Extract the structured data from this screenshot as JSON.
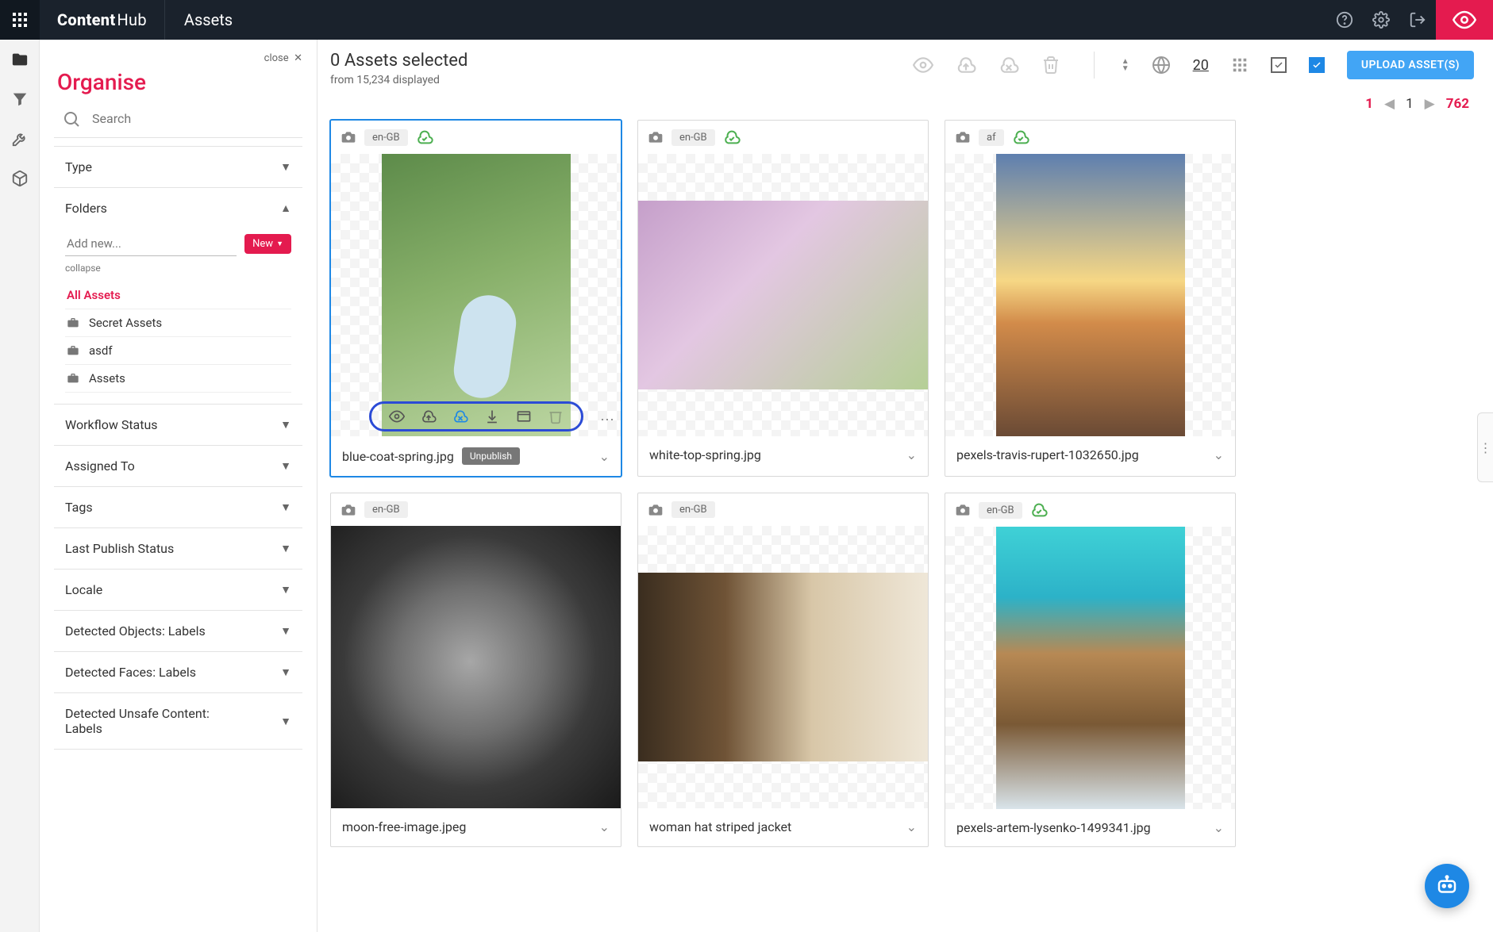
{
  "header": {
    "brand_bold": "Content",
    "brand_light": "Hub",
    "section": "Assets"
  },
  "sidebar": {
    "close_label": "close",
    "title": "Organise",
    "search_placeholder": "Search",
    "new_button": "New",
    "addnew_placeholder": "Add new...",
    "collapse_label": "collapse",
    "all_assets_label": "All Assets",
    "folders": [
      "Secret Assets",
      "asdf",
      "Assets"
    ],
    "accordion": {
      "type": "Type",
      "folders": "Folders",
      "workflow": "Workflow Status",
      "assigned": "Assigned To",
      "tags": "Tags",
      "last_publish": "Last Publish Status",
      "locale": "Locale",
      "objects": "Detected Objects: Labels",
      "faces": "Detected Faces: Labels",
      "unsafe": "Detected Unsafe Content: Labels"
    }
  },
  "main": {
    "selected_text": "0 Assets selected",
    "from_text": "from 15,234 displayed",
    "page_size": "20",
    "upload_label": "UPLOAD ASSET(S)",
    "pager": {
      "current_first": "1",
      "current": "1",
      "total": "762"
    }
  },
  "cards": [
    {
      "locale": "en-GB",
      "cloud": true,
      "filename": "blue-coat-spring.jpg",
      "pill": "Unpublish",
      "selected": true,
      "hover": true
    },
    {
      "locale": "en-GB",
      "cloud": true,
      "filename": "white-top-spring.jpg",
      "pill": null,
      "selected": false,
      "hover": false
    },
    {
      "locale": "af",
      "cloud": true,
      "filename": "pexels-travis-rupert-1032650.jpg",
      "pill": null,
      "selected": false,
      "hover": false
    },
    {
      "locale": "en-GB",
      "cloud": false,
      "filename": "moon-free-image.jpeg",
      "pill": null,
      "selected": false,
      "hover": false
    },
    {
      "locale": "en-GB",
      "cloud": false,
      "filename": "woman hat striped jacket",
      "pill": null,
      "selected": false,
      "hover": false
    },
    {
      "locale": "en-GB",
      "cloud": true,
      "filename": "pexels-artem-lysenko-1499341.jpg",
      "pill": null,
      "selected": false,
      "hover": false
    }
  ]
}
